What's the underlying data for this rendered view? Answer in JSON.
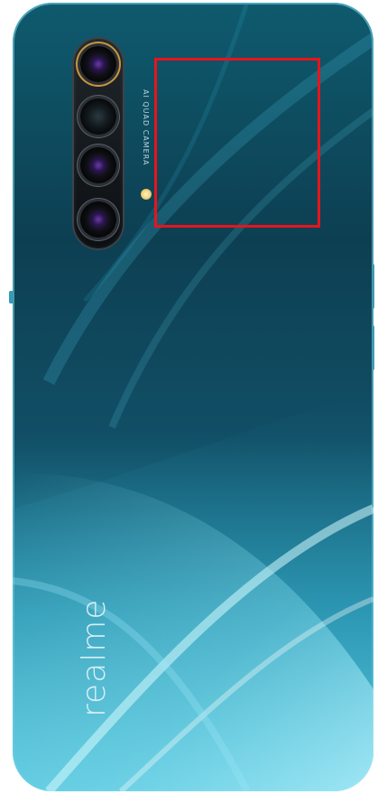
{
  "image": {
    "subject": "smartphone back panel",
    "camera_label": "AI QUAD CAMERA",
    "brand_label": "realme",
    "colors": {
      "body_dark": "#0d3f52",
      "body_light": "#68d1e6",
      "lens_ring_accent": "#c8953e",
      "highlight_box": "#e8141b"
    },
    "lens_count": 4,
    "flash": true
  }
}
